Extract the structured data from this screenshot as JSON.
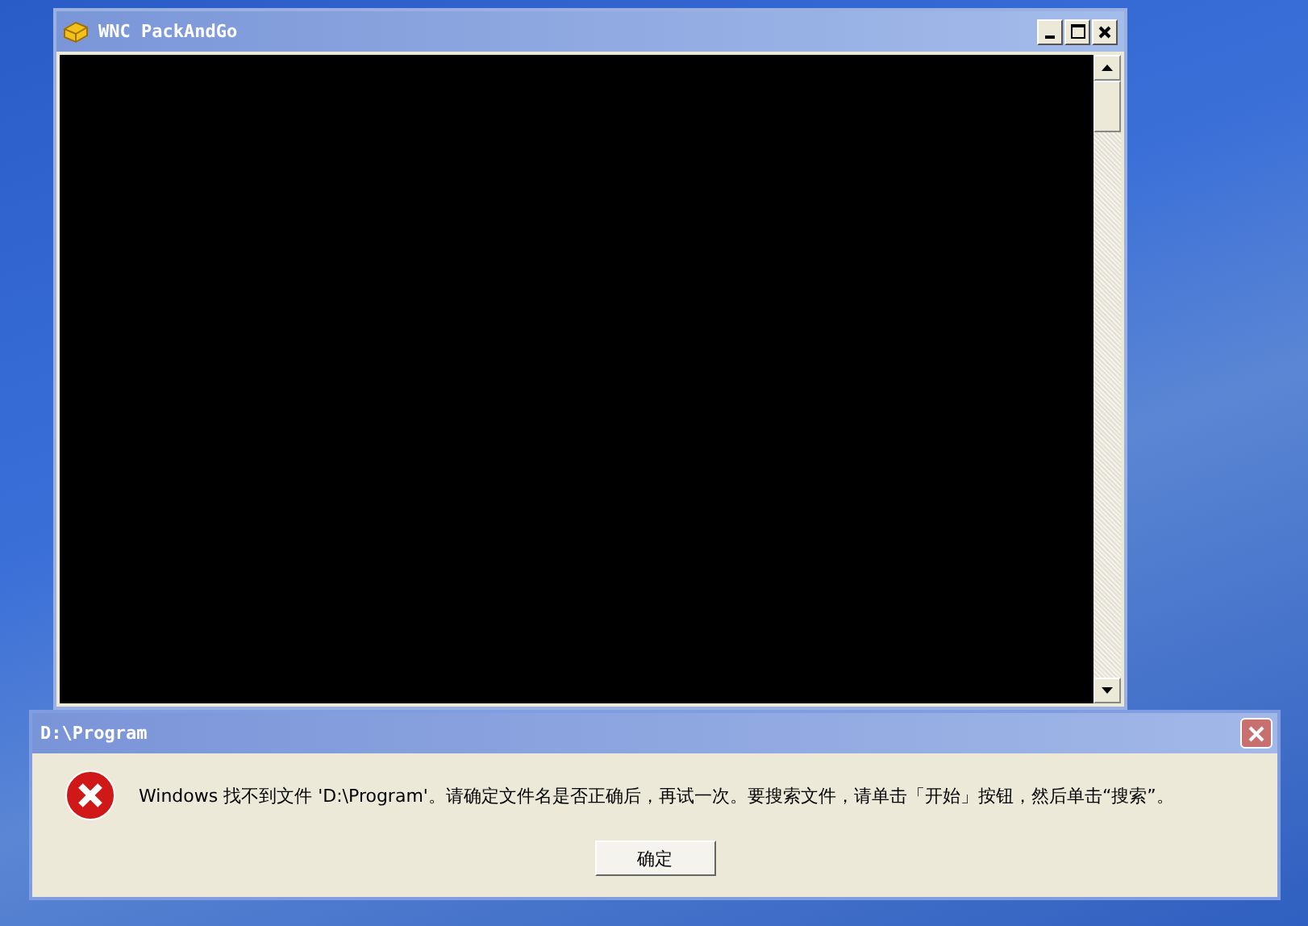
{
  "console_window": {
    "title": "WNC PackAndGo"
  },
  "dialog": {
    "title": "D:\\Program",
    "message": "Windows 找不到文件 'D:\\Program'。请确定文件名是否正确后，再试一次。要搜索文件，请单击「开始」按钮，然后单击“搜索”。",
    "buttons": [
      "确定"
    ]
  }
}
